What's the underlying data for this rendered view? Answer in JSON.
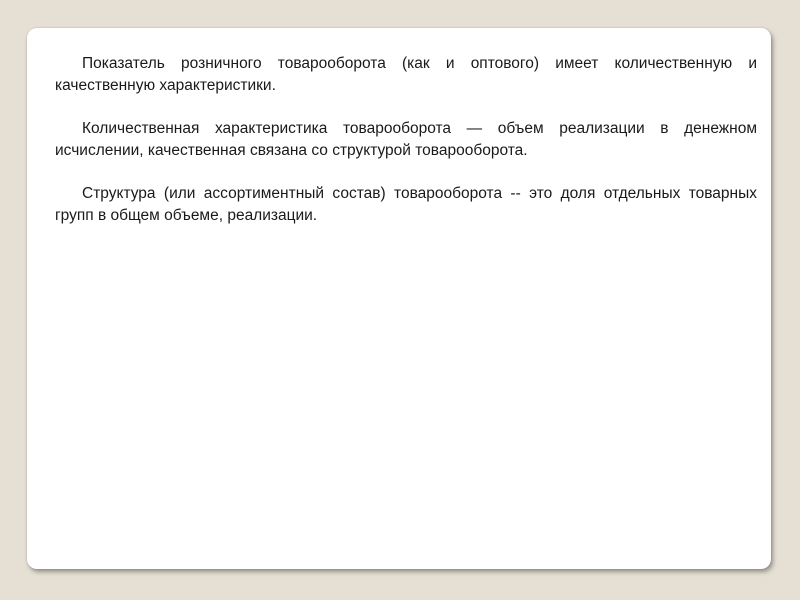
{
  "slide": {
    "paragraphs": [
      "Показатель розничного товарооборота (как и оптового) имеет количественную и качественную характеристики.",
      "Количественная характеристика товарооборота — объем реализации в денежном исчислении, качественная связана со структурой товарооборота.",
      "Структура (или ассортиментный состав) товарооборота -- это доля отдельных товарных групп в общем объеме, реализации."
    ]
  },
  "colors": {
    "background": "#e6e0d4",
    "card": "#ffffff",
    "text": "#1a1a1a"
  }
}
